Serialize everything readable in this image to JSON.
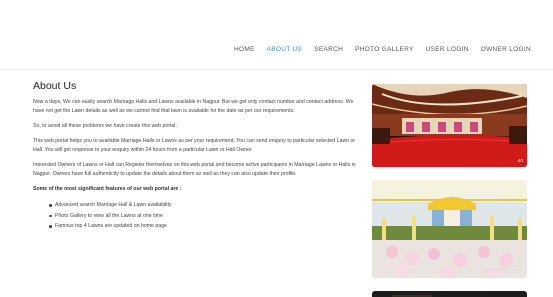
{
  "nav": {
    "items": [
      {
        "label": "HOME"
      },
      {
        "label": "ABOUT US"
      },
      {
        "label": "SEARCH"
      },
      {
        "label": "PHOTO GALLERY"
      },
      {
        "label": "USER LOGIN"
      },
      {
        "label": "OWNER LOGIN"
      }
    ]
  },
  "about": {
    "title": "About Us",
    "p1": "Now a days, We can easily search Marriage Halls and Lawns available in Nagpur. But we get only contact number and contact address. We have not get the Lawn details as well as we cannot find that lawn is available for the date as per our requirements.",
    "p2": "So, to avoid all these problems we have create this web portal.",
    "p3": "This web portal helps you to available Marriage Halls or Lawns as per your requirement. You can send enquiry to particular selected Lawn or Hall. You will get response to your enquiry within 24 hours from a particular Lawn or Hall Owner.",
    "p4": "Interested Owners of Lawns or Hall can Register themselves on this web portal and become active participants in Marriage Lawns or Halls in Nagpur. Owners have full authenticity to update the details about them as well as they can also update their profile.",
    "features_heading": "Some of the most significant features of our web portal are :",
    "features": [
      "Advanced search Marriage Hall & Lawn availability",
      "Photo Gallery to view all the Lawns at one time",
      "Famous top 4 Lawns are updated on home page"
    ]
  },
  "gallery": {
    "photo1_caption": "40",
    "photo2_caption": "shutterstock.com"
  }
}
